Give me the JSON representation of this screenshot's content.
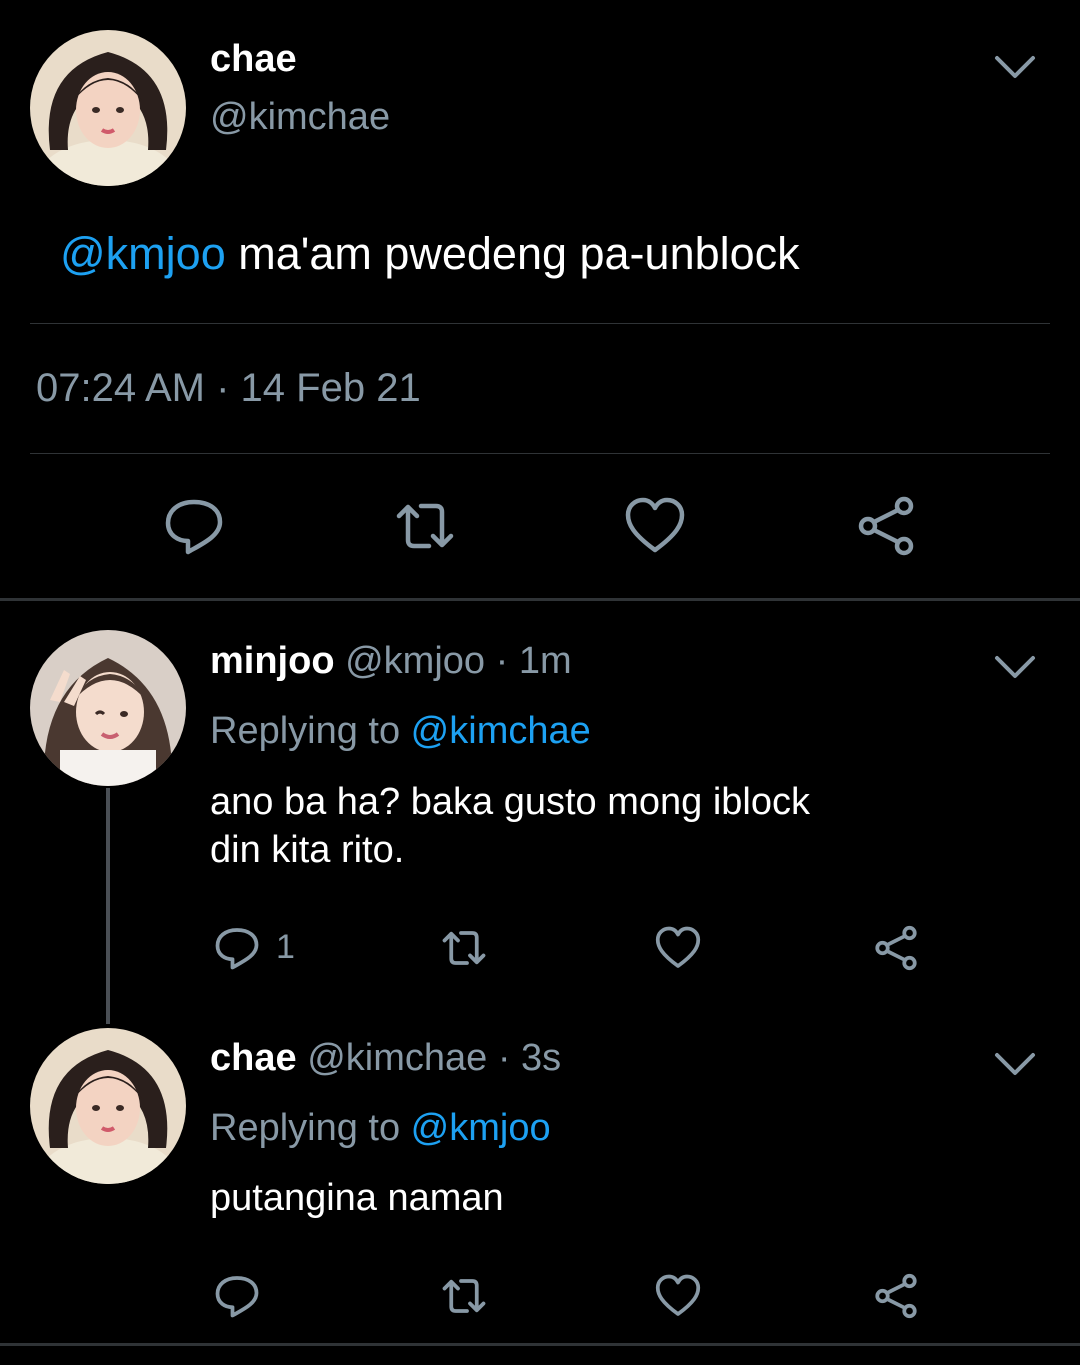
{
  "main_tweet": {
    "name": "chae",
    "handle": "@kimchae",
    "mention": "@kmjoo",
    "text": " ma'am pwedeng pa-unblock",
    "timestamp": "07:24 AM · 14 Feb 21",
    "avatar_icon": "profile-photo",
    "actions": [
      "reply-icon",
      "retweet-icon",
      "like-icon",
      "share-icon"
    ]
  },
  "replies": [
    {
      "name": "minjoo",
      "handle": "@kmjoo",
      "time": " · 1m",
      "replying_label": "Replying to ",
      "replying_handle": "@kimchae",
      "text_line1": "ano ba ha? baka gusto mong iblock",
      "text_line2": "din kita rito.",
      "reply_count": "1"
    },
    {
      "name": "chae",
      "handle": "@kimchae",
      "time": " · 3s",
      "replying_label": "Replying to ",
      "replying_handle": "@kmjoo",
      "text_line1": "putangina naman",
      "reply_count": ""
    }
  ],
  "colors": {
    "background": "#000000",
    "accent": "#1da1f2",
    "secondary_text": "#8899a6",
    "divider": "#2f3336"
  }
}
